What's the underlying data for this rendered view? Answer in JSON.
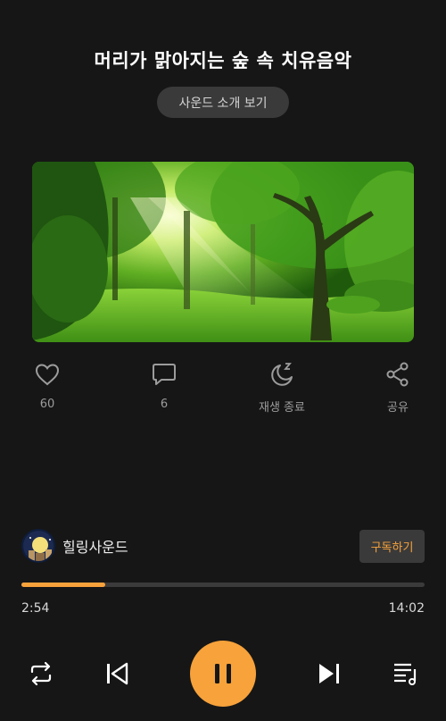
{
  "header": {
    "title": "머리가 맑아지는 숲 속 치유음악",
    "intro_button": "사운드 소개 보기"
  },
  "artwork": {
    "alt": "forest-sunlight-image"
  },
  "actions": [
    {
      "icon": "heart-icon",
      "label": "60"
    },
    {
      "icon": "comment-icon",
      "label": "6"
    },
    {
      "icon": "sleep-timer-icon",
      "label": "재생 종료"
    },
    {
      "icon": "share-icon",
      "label": "공유"
    }
  ],
  "channel": {
    "name": "힐링사운드",
    "subscribe_label": "구독하기"
  },
  "player": {
    "progress": 0.207,
    "elapsed": "2:54",
    "duration": "14:02"
  },
  "colors": {
    "accent": "#f7a23b",
    "background": "#161616",
    "chip": "#3a3a3a"
  },
  "controls": [
    "repeat-icon",
    "previous-icon",
    "pause-icon",
    "next-icon",
    "playlist-icon"
  ]
}
